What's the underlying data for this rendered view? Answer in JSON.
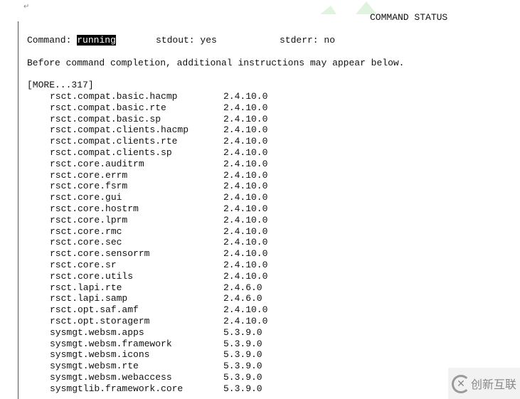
{
  "header": {
    "title": "COMMAND STATUS"
  },
  "status": {
    "command_label": "Command:",
    "command_value": "running",
    "stdout_label": "stdout:",
    "stdout_value": "yes",
    "stderr_label": "stderr:",
    "stderr_value": "no"
  },
  "notice": "Before command completion, additional instructions may appear below.",
  "more": "[MORE...317]",
  "packages": [
    {
      "name": "rsct.compat.basic.hacmp",
      "version": "2.4.10.0"
    },
    {
      "name": "rsct.compat.basic.rte",
      "version": "2.4.10.0"
    },
    {
      "name": "rsct.compat.basic.sp",
      "version": "2.4.10.0"
    },
    {
      "name": "rsct.compat.clients.hacmp",
      "version": "2.4.10.0"
    },
    {
      "name": "rsct.compat.clients.rte",
      "version": "2.4.10.0"
    },
    {
      "name": "rsct.compat.clients.sp",
      "version": "2.4.10.0"
    },
    {
      "name": "rsct.core.auditrm",
      "version": "2.4.10.0"
    },
    {
      "name": "rsct.core.errm",
      "version": "2.4.10.0"
    },
    {
      "name": "rsct.core.fsrm",
      "version": "2.4.10.0"
    },
    {
      "name": "rsct.core.gui",
      "version": "2.4.10.0"
    },
    {
      "name": "rsct.core.hostrm",
      "version": "2.4.10.0"
    },
    {
      "name": "rsct.core.lprm",
      "version": "2.4.10.0"
    },
    {
      "name": "rsct.core.rmc",
      "version": "2.4.10.0"
    },
    {
      "name": "rsct.core.sec",
      "version": "2.4.10.0"
    },
    {
      "name": "rsct.core.sensorrm",
      "version": "2.4.10.0"
    },
    {
      "name": "rsct.core.sr",
      "version": "2.4.10.0"
    },
    {
      "name": "rsct.core.utils",
      "version": "2.4.10.0"
    },
    {
      "name": "rsct.lapi.rte",
      "version": "2.4.6.0"
    },
    {
      "name": "rsct.lapi.samp",
      "version": "2.4.6.0"
    },
    {
      "name": "rsct.opt.saf.amf",
      "version": "2.4.10.0"
    },
    {
      "name": "rsct.opt.storagerm",
      "version": "2.4.10.0"
    },
    {
      "name": "sysmgt.websm.apps",
      "version": "5.3.9.0"
    },
    {
      "name": "sysmgt.websm.framework",
      "version": "5.3.9.0"
    },
    {
      "name": "sysmgt.websm.icons",
      "version": "5.3.9.0"
    },
    {
      "name": "sysmgt.websm.rte",
      "version": "5.3.9.0"
    },
    {
      "name": "sysmgt.websm.webaccess",
      "version": "5.3.9.0"
    },
    {
      "name": "sysmgtlib.framework.core",
      "version": "5.3.9.0"
    }
  ],
  "watermark": {
    "text": "创新互联",
    "icon": "brand-logo-icon"
  },
  "colors": {
    "highlight_bg": "#000000",
    "highlight_fg": "#ffffff"
  }
}
